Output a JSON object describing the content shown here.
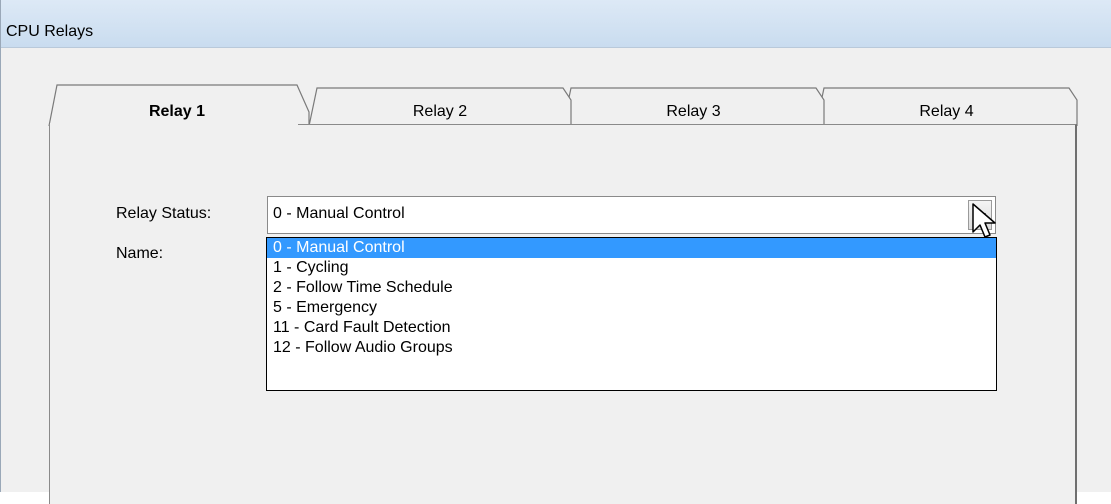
{
  "window": {
    "title": "CPU Relays"
  },
  "tabs": [
    {
      "label": "Relay 1",
      "active": true
    },
    {
      "label": "Relay 2",
      "active": false
    },
    {
      "label": "Relay 3",
      "active": false
    },
    {
      "label": "Relay 4",
      "active": false
    }
  ],
  "form": {
    "relay_status_label": "Relay Status:",
    "name_label": "Name:",
    "relay_status_value": "0 - Manual Control"
  },
  "dropdown": {
    "options": [
      "0 - Manual Control",
      "1 - Cycling",
      "2 - Follow Time Schedule",
      "5 - Emergency",
      "11 - Card Fault Detection",
      "12 - Follow Audio Groups"
    ],
    "selected_index": 0
  },
  "icons": {
    "combo_arrow": "chevron-down-icon",
    "cursor": "mouse-pointer-icon"
  },
  "colors": {
    "selection": "#3399ff",
    "titlebar": "#c9dcef"
  }
}
